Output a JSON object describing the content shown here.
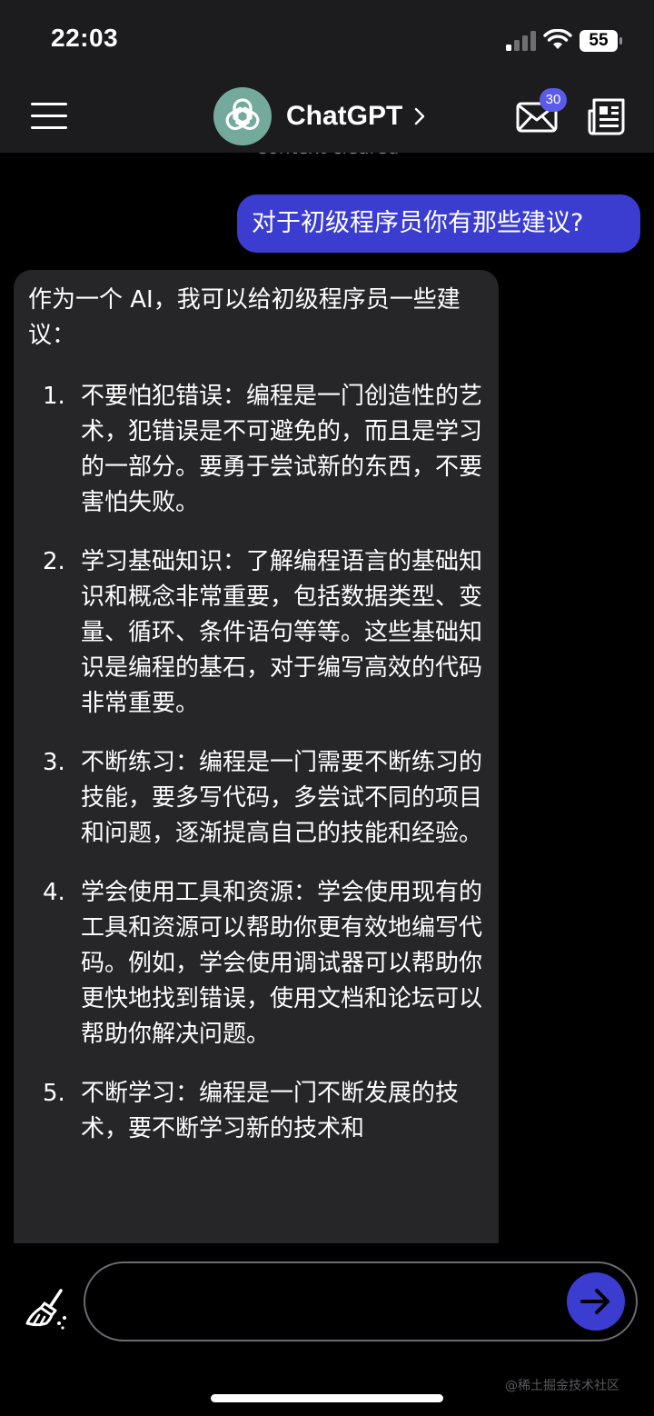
{
  "status_bar": {
    "time": "22:03",
    "battery": "55"
  },
  "nav": {
    "title": "ChatGPT",
    "mail_badge": "30"
  },
  "chat": {
    "context_notice": "Context cleared",
    "user_message": "对于初级程序员你有那些建议?",
    "assistant_intro": "作为一个 AI，我可以给初级程序员一些建议：",
    "assistant_items": [
      {
        "number": "1.",
        "text": "不要怕犯错误：编程是一门创造性的艺术，犯错误是不可避免的，而且是学习的一部分。要勇于尝试新的东西，不要害怕失败。"
      },
      {
        "number": "2.",
        "text": "学习基础知识：了解编程语言的基础知识和概念非常重要，包括数据类型、变量、循环、条件语句等等。这些基础知识是编程的基石，对于编写高效的代码非常重要。"
      },
      {
        "number": "3.",
        "text": "不断练习：编程是一门需要不断练习的技能，要多写代码，多尝试不同的项目和问题，逐渐提高自己的技能和经验。"
      },
      {
        "number": "4.",
        "text": "学会使用工具和资源：学会使用现有的工具和资源可以帮助你更有效地编写代码。例如，学会使用调试器可以帮助你更快地找到错误，使用文档和论坛可以帮助你解决问题。"
      },
      {
        "number": "5.",
        "text": "不断学习：编程是一门不断发展的技术，要不断学习新的技术和"
      }
    ]
  },
  "composer": {
    "input_value": "",
    "input_placeholder": ""
  },
  "watermark": "@稀土掘金技术社区",
  "colors": {
    "header_bg": "#1c1c1e",
    "user_bubble": "#3b3dd1",
    "assistant_bubble": "#262628",
    "logo_bg": "#74aa9c",
    "badge": "#5a5be8"
  },
  "icons": {
    "menu": "hamburger-menu-icon",
    "logo": "openai-logo-icon",
    "mail": "mail-icon",
    "news": "newspaper-icon",
    "clear": "broom-icon",
    "send": "arrow-right-icon"
  }
}
